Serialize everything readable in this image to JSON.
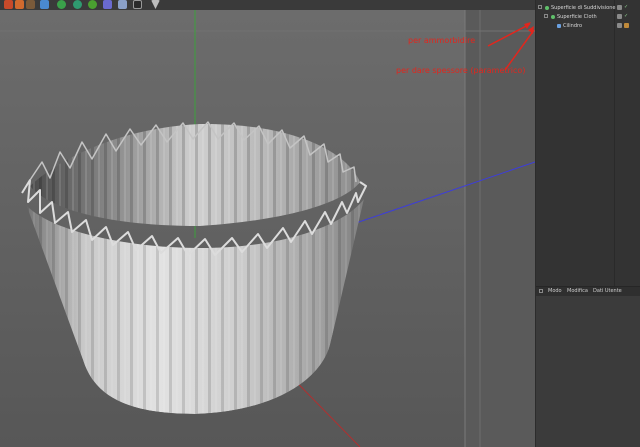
{
  "viewport": {
    "annotations": {
      "soften": "per ammorbidire",
      "thickness": "per dare spessore (parametrico)"
    },
    "colors": {
      "annotation": "#e2261d",
      "y_axis": "#3ca03c",
      "x_axis": "#3d3ddb",
      "z_axis": "#b03030"
    }
  },
  "toolbar": {
    "icons": [
      "cube-icon",
      "sphere-green-icon",
      "sphere-green-icon",
      "pen-icon",
      "grid-icon",
      "camera-icon",
      "dropdown-icon"
    ]
  },
  "objects": {
    "items": [
      {
        "label": "Superficie di Suddivisione",
        "icon": "subdivision-icon"
      },
      {
        "label": "Superficie Cloth",
        "icon": "cloth-icon"
      },
      {
        "label": "Cilindro",
        "icon": "cylinder-icon"
      }
    ]
  },
  "attributes": {
    "tabs": [
      "Modo",
      "Modifica",
      "Dati Utente"
    ]
  }
}
